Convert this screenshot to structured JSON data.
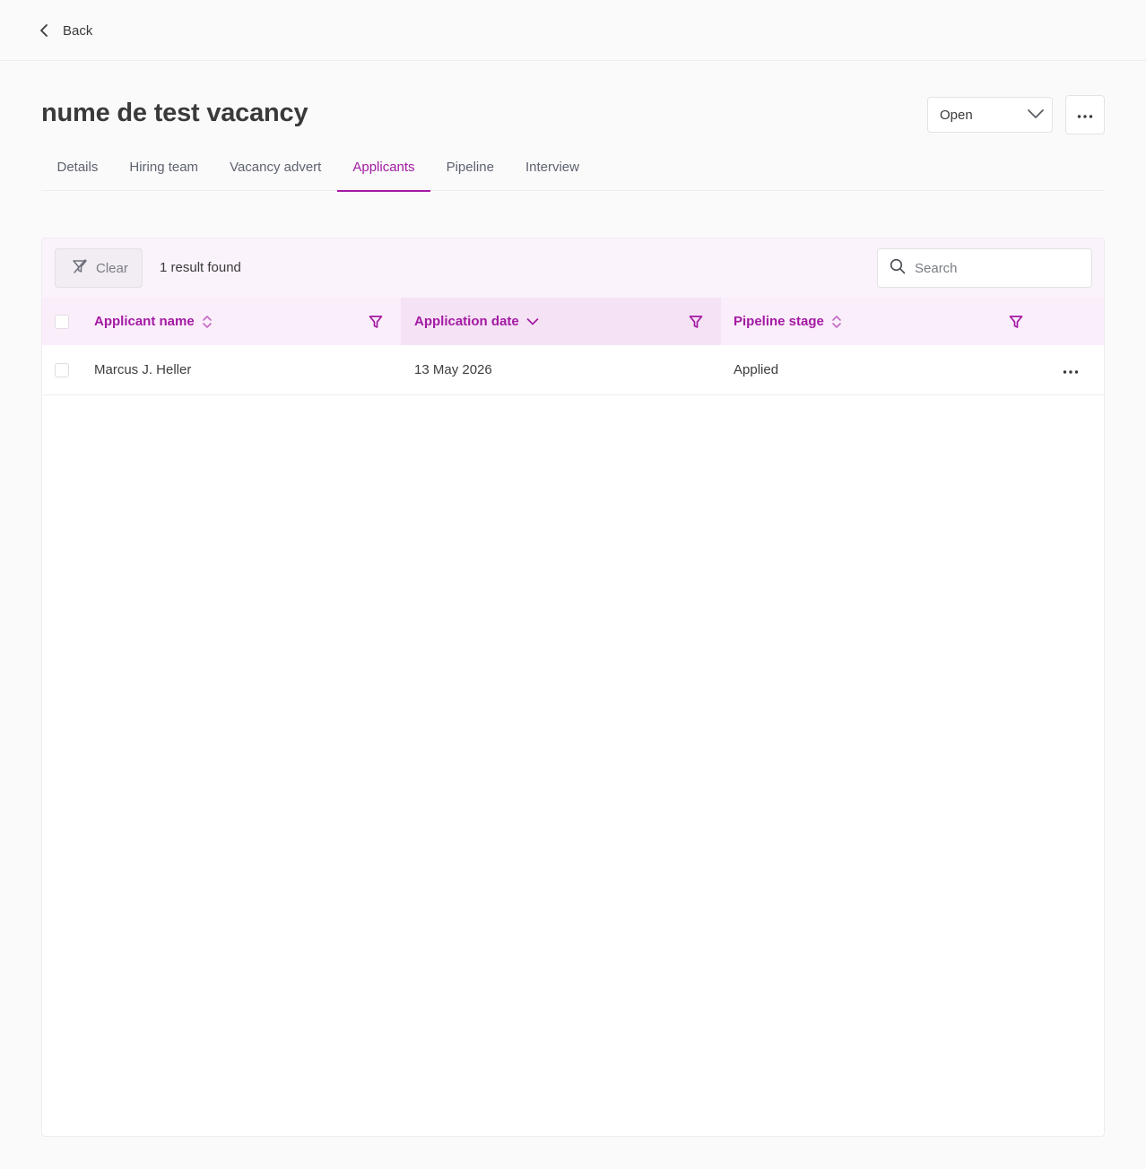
{
  "header": {
    "back_label": "Back"
  },
  "page": {
    "title": "nume de test vacancy",
    "status_value": "Open"
  },
  "tabs": [
    {
      "label": "Details",
      "active": false
    },
    {
      "label": "Hiring team",
      "active": false
    },
    {
      "label": "Vacancy advert",
      "active": false
    },
    {
      "label": "Applicants",
      "active": true
    },
    {
      "label": "Pipeline",
      "active": false
    },
    {
      "label": "Interview",
      "active": false
    }
  ],
  "toolbar": {
    "clear_label": "Clear",
    "result_count": "1 result found",
    "search_placeholder": "Search",
    "search_value": ""
  },
  "table": {
    "columns": [
      {
        "label": "Applicant name",
        "sort": "unsorted"
      },
      {
        "label": "Application date",
        "sort": "descending"
      },
      {
        "label": "Pipeline stage",
        "sort": "unsorted"
      }
    ],
    "rows": [
      {
        "applicant_name": "Marcus J. Heller",
        "application_date": "13 May 2026",
        "pipeline_stage": "Applied"
      }
    ]
  },
  "colors": {
    "accent": "#a31aa3",
    "header_bg": "#fbeefb",
    "sorted_column_bg": "#f5e2f5",
    "toolbar_bg": "#fbf3fb"
  },
  "icons": {
    "back": "chevron-left-icon",
    "dropdown": "chevron-down-icon",
    "more": "more-horizontal-icon",
    "clear": "filter-clear-icon",
    "search": "search-icon",
    "sort_unsorted": "sort-icon",
    "sort_desc": "chevron-down-icon",
    "filter": "filter-icon"
  }
}
